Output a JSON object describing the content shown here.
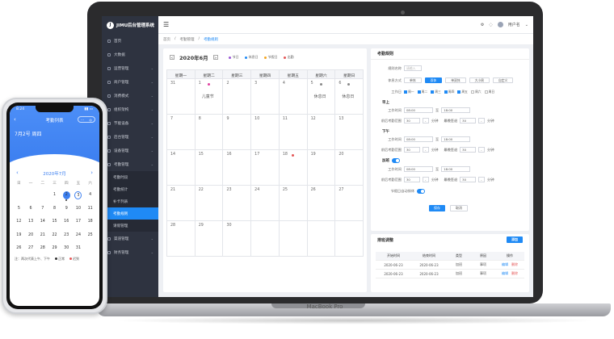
{
  "macbook": {
    "label": "MacBook Pro"
  },
  "app": {
    "name": "JIMU后台管理系统",
    "logo_letter": "J"
  },
  "topbar": {
    "user": "用户名"
  },
  "sidebar": {
    "items": [
      {
        "label": "首页"
      },
      {
        "label": "大数据"
      },
      {
        "label": "运营管理"
      },
      {
        "label": "商户管理"
      },
      {
        "label": "消费模式"
      },
      {
        "label": "组织架构"
      },
      {
        "label": "节能设备"
      },
      {
        "label": "后台管理"
      },
      {
        "label": "设备管理"
      },
      {
        "label": "考勤管理"
      }
    ],
    "sub_items": [
      {
        "label": "考勤时段"
      },
      {
        "label": "考勤统计"
      },
      {
        "label": "补卡列表"
      },
      {
        "label": "考勤规则"
      },
      {
        "label": "请假管理"
      }
    ],
    "after_items": [
      {
        "label": "渠道管理"
      },
      {
        "label": "财务管理"
      }
    ]
  },
  "breadcrumb": {
    "home": "首页",
    "parent": "考勤管理",
    "current": "考勤规则"
  },
  "calendar": {
    "prev": "<",
    "next": ">",
    "title": "2020年6月",
    "legend": [
      {
        "label": "节日",
        "color": "#9b59d6"
      },
      {
        "label": "休息日",
        "color": "#1f8af5"
      },
      {
        "label": "节假日",
        "color": "#f5a623"
      },
      {
        "label": "出勤",
        "color": "#e45757"
      }
    ],
    "weekdays": [
      "星期一",
      "星期二",
      "星期三",
      "星期四",
      "星期五",
      "星期六",
      "星期日"
    ],
    "weeks": [
      [
        {
          "d": "31"
        },
        {
          "d": "1",
          "ev": "儿童节",
          "dot": "#e040a0"
        },
        {
          "d": "2"
        },
        {
          "d": "3"
        },
        {
          "d": "4"
        },
        {
          "d": "5",
          "ev": "休息日",
          "dot": "#888"
        },
        {
          "d": "6",
          "ev": "休息日",
          "dot": "#888"
        }
      ],
      [
        {
          "d": "7"
        },
        {
          "d": "8"
        },
        {
          "d": "9"
        },
        {
          "d": "10"
        },
        {
          "d": "11"
        },
        {
          "d": "12"
        },
        {
          "d": "13"
        }
      ],
      [
        {
          "d": "14"
        },
        {
          "d": "15"
        },
        {
          "d": "16"
        },
        {
          "d": "17"
        },
        {
          "d": "18",
          "dot": "#e45757"
        },
        {
          "d": "19"
        },
        {
          "d": "20"
        }
      ],
      [
        {
          "d": "21"
        },
        {
          "d": "22"
        },
        {
          "d": "23"
        },
        {
          "d": "24"
        },
        {
          "d": "25"
        },
        {
          "d": "26"
        },
        {
          "d": "27"
        }
      ],
      [
        {
          "d": "28"
        },
        {
          "d": "29"
        },
        {
          "d": "30"
        },
        {
          "d": ""
        },
        {
          "d": ""
        },
        {
          "d": ""
        },
        {
          "d": ""
        }
      ]
    ]
  },
  "settings": {
    "title": "考勤规则",
    "rule_name_label": "规则名称",
    "rule_name_placeholder": "请输入",
    "mode_label": "休息方式",
    "modes": [
      "单休",
      "双休",
      "单双休",
      "大小周",
      "自定义"
    ],
    "active_mode": "双休",
    "workday_label": "工作日",
    "workdays": [
      "周一",
      "周二",
      "周三",
      "周四",
      "周五",
      "周六",
      "周日"
    ],
    "morning_label": "早上",
    "afternoon_label": "下午",
    "overtime_label": "加班",
    "work_time_label": "工作时间",
    "to": "至",
    "t_start": "08:00",
    "t_end": "18:00",
    "checkin_range_label": "前后考勤范围",
    "before_val": "30",
    "after_val": "30",
    "minute": "分钟",
    "flex_label": "最晚签退",
    "flex_val": "30",
    "auto_label": "节假日自动排休",
    "save": "保存",
    "cancel": "取消"
  },
  "schedule": {
    "title": "排班调整",
    "add": "添加",
    "headers": [
      "开始时间",
      "结束时间",
      "类型",
      "原因",
      "操作"
    ],
    "rows": [
      {
        "start": "2020-06-23",
        "end": "2020-06-23",
        "type": "加班",
        "reason": "事项",
        "edit": "编辑",
        "del": "删除"
      },
      {
        "start": "2020-06-23",
        "end": "2020-06-23",
        "type": "加班",
        "reason": "事项",
        "edit": "编辑",
        "del": "删除"
      }
    ]
  },
  "phone": {
    "time": "8:24",
    "title": "考勤列表",
    "date_label": "7月2号 周四",
    "month": "2020年7月",
    "weekdays": [
      "日",
      "一",
      "二",
      "三",
      "四",
      "五",
      "六"
    ],
    "rows": [
      [
        "",
        "",
        "",
        "1",
        "2",
        "3",
        "4"
      ],
      [
        "5",
        "6",
        "7",
        "8",
        "9",
        "10",
        "11"
      ],
      [
        "12",
        "13",
        "14",
        "15",
        "16",
        "17",
        "18"
      ],
      [
        "19",
        "20",
        "21",
        "22",
        "23",
        "24",
        "25"
      ],
      [
        "26",
        "27",
        "28",
        "29",
        "30",
        "31",
        ""
      ]
    ],
    "today": "2",
    "selected": "3",
    "note_text": "注：两次代表上午、下午",
    "note_normal": "正常",
    "note_late": "迟到"
  }
}
